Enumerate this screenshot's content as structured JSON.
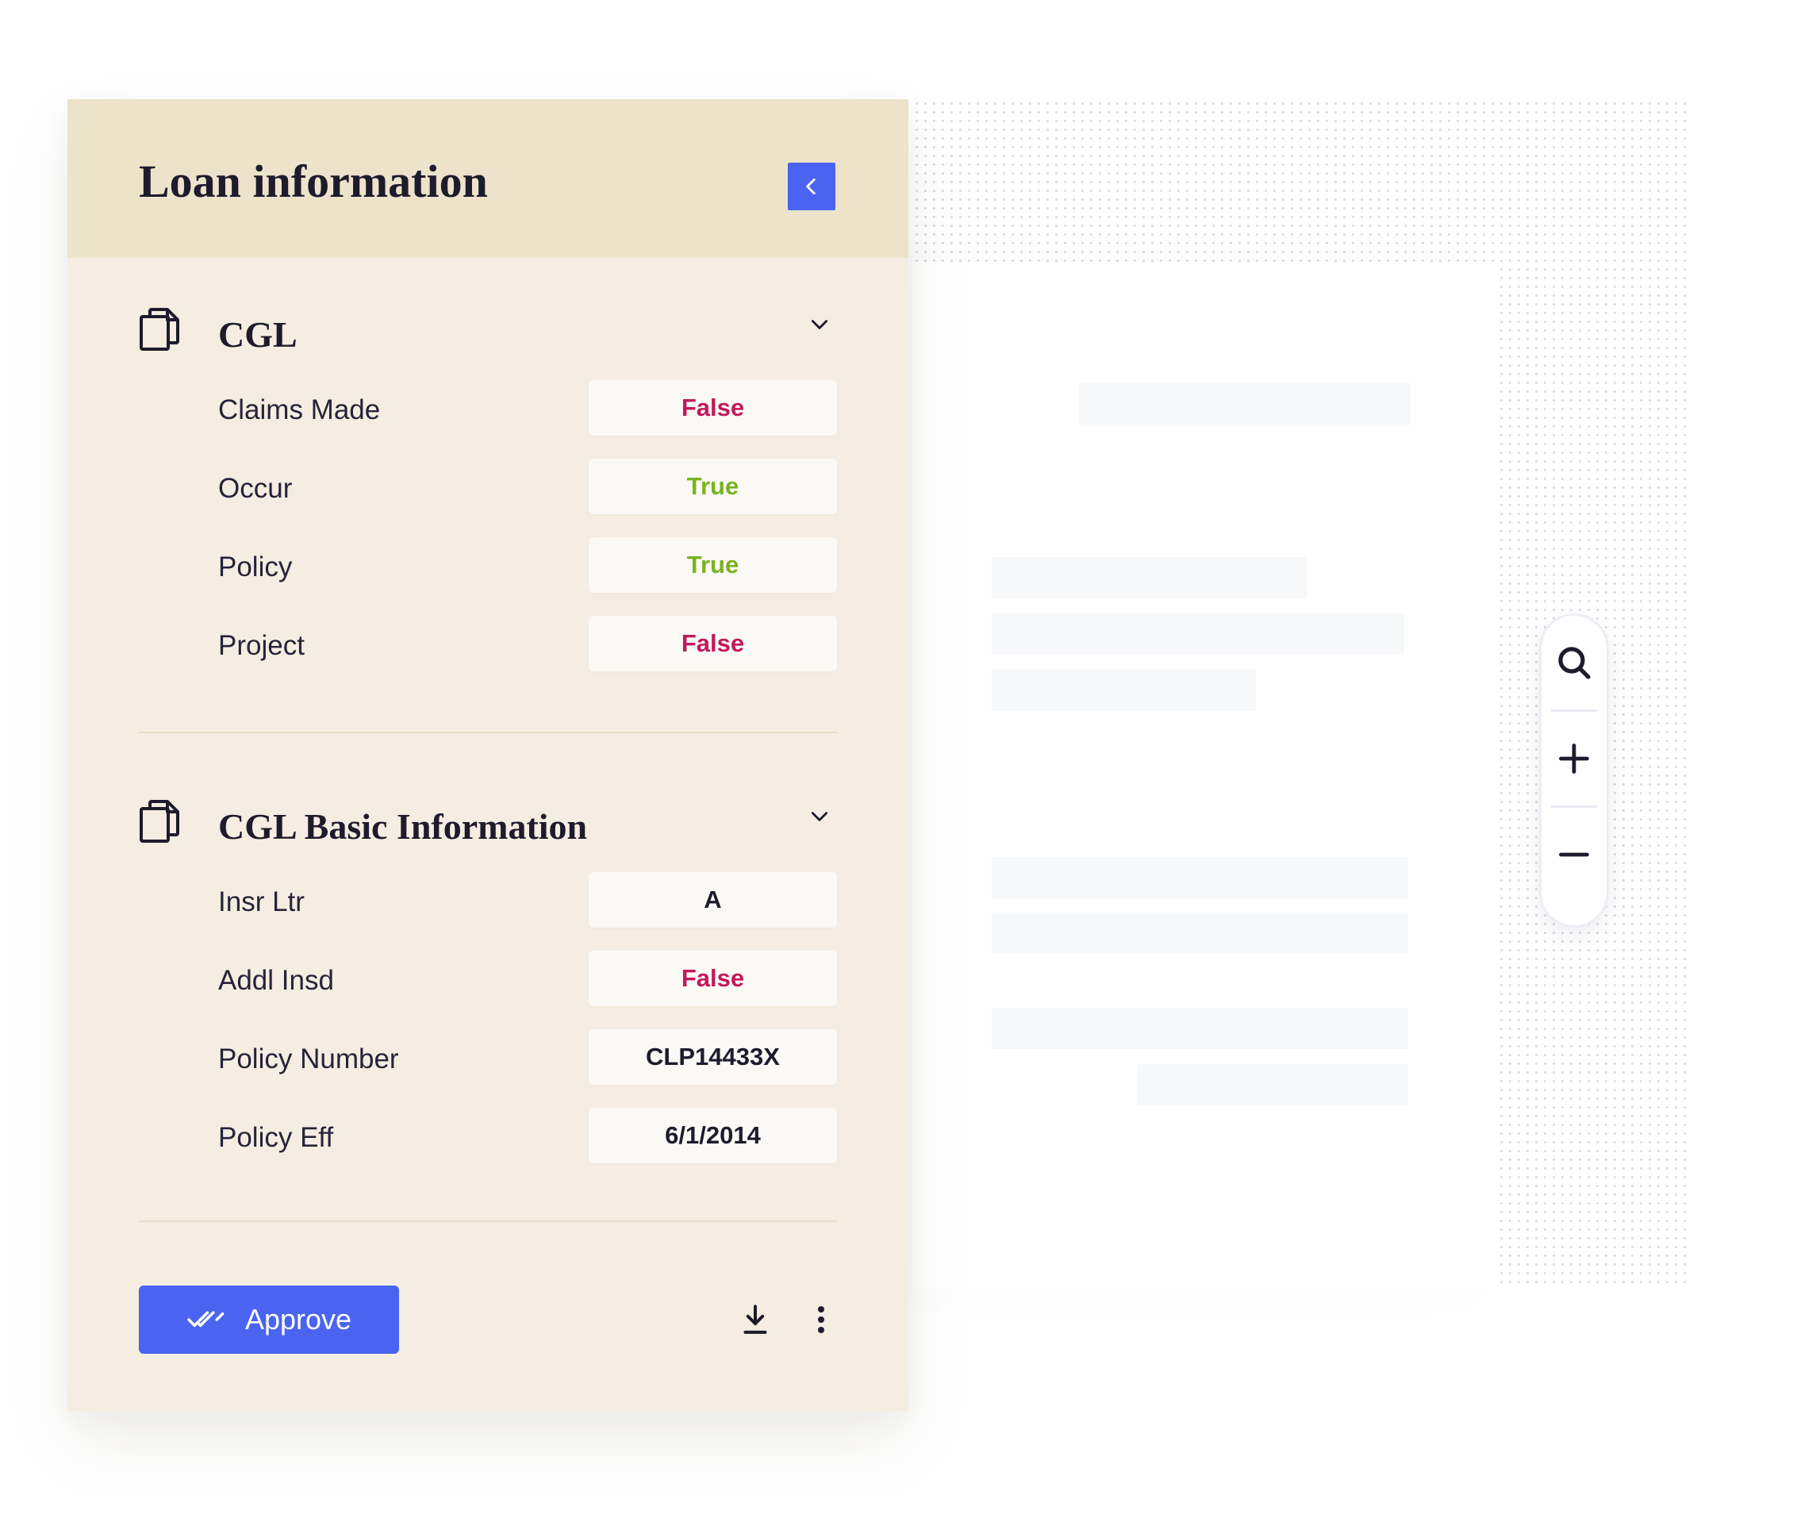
{
  "panel": {
    "title": "Loan information",
    "collapse_icon": "chevron-left-icon"
  },
  "sections": [
    {
      "title": "CGL",
      "icon": "document-icon",
      "rows": [
        {
          "label": "Claims Made",
          "value": "False"
        },
        {
          "label": "Occur",
          "value": "True"
        },
        {
          "label": "Policy",
          "value": "True"
        },
        {
          "label": "Project",
          "value": "False"
        }
      ]
    },
    {
      "title": "CGL Basic Information",
      "icon": "document-icon",
      "rows": [
        {
          "label": "Insr Ltr",
          "value": "A"
        },
        {
          "label": "Addl Insd",
          "value": "False"
        },
        {
          "label": "Policy Number",
          "value": "CLP14433X"
        },
        {
          "label": "Policy Eff",
          "value": "6/1/2014"
        }
      ]
    }
  ],
  "footer": {
    "approve_label": "Approve",
    "approve_icon": "double-check-icon",
    "download_icon": "download-icon",
    "more_icon": "more-vertical-icon"
  },
  "zoom": {
    "search_icon": "search-icon",
    "zoom_in_icon": "plus-icon",
    "zoom_out_icon": "minus-icon"
  },
  "colors": {
    "accent": "#4a63f0",
    "false_value": "#c2185b",
    "true_value": "#78b41e",
    "panel_bg": "#f5ede1",
    "header_bg": "#ede3ca"
  }
}
